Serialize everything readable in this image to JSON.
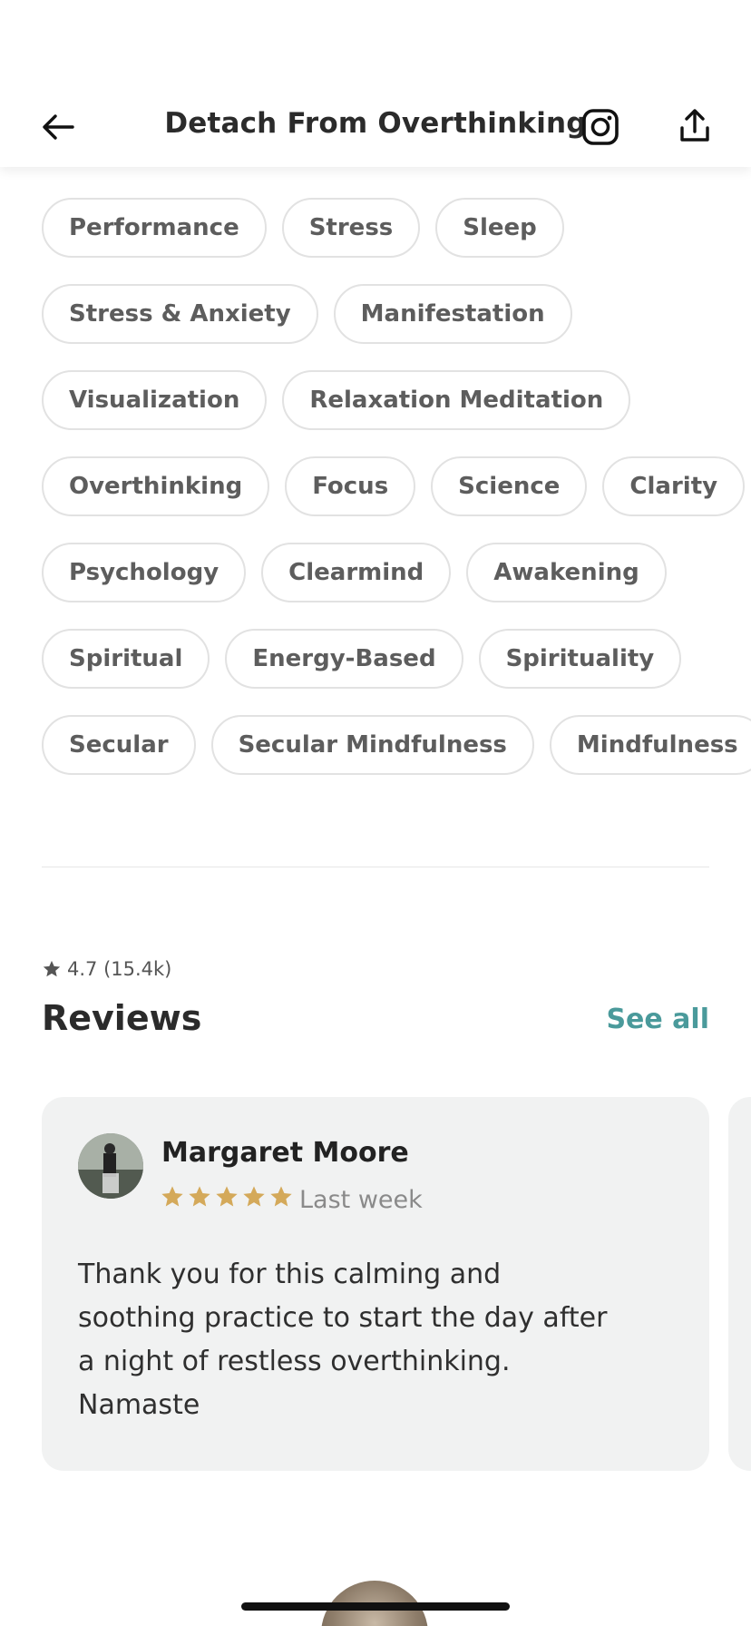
{
  "header": {
    "title": "Detach From Overthinking",
    "back_icon": "back-arrow-icon",
    "instagram_icon": "instagram-icon",
    "share_icon": "share-icon"
  },
  "tags": {
    "rows": [
      [
        "Performance",
        "Stress",
        "Sleep"
      ],
      [
        "Stress & Anxiety",
        "Manifestation"
      ],
      [
        "Visualization",
        "Relaxation Meditation"
      ],
      [
        "Overthinking",
        "Focus",
        "Science",
        "Clarity"
      ],
      [
        "Psychology",
        "Clearmind",
        "Awakening"
      ],
      [
        "Spiritual",
        "Energy-Based",
        "Spirituality"
      ],
      [
        "Secular",
        "Secular Mindfulness",
        "Mindfulness"
      ]
    ]
  },
  "reviews": {
    "rating": "4.7 (15.4k)",
    "title": "Reviews",
    "see_all": "See all",
    "items": [
      {
        "name": "Margaret Moore",
        "stars": 5,
        "when": "Last week",
        "text": "Thank you for this calming and soothing practice to start the day after a night of restless overthinking. Namaste"
      }
    ]
  },
  "colors": {
    "accent": "#4a9a9b",
    "star": "#d4a95a",
    "card_bg": "#f1f2f2"
  }
}
